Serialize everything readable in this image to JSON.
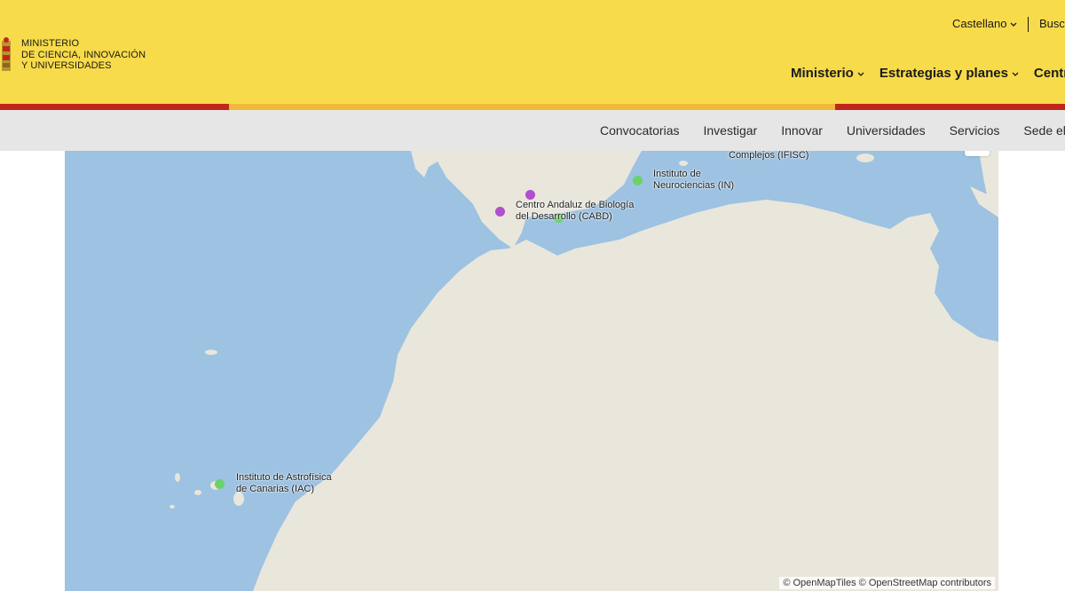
{
  "header": {
    "logo_lines": [
      "MINISTERIO",
      "DE CIENCIA, INNOVACIÓN",
      "Y UNIVERSIDADES"
    ],
    "language": "Castellano",
    "search": "Busc",
    "main_nav": [
      "Ministerio",
      "Estrategias y planes",
      "Centr"
    ]
  },
  "subnav": [
    "Convocatorias",
    "Investigar",
    "Innovar",
    "Universidades",
    "Servicios",
    "Sede elec"
  ],
  "map": {
    "attribution": "© OpenMapTiles © OpenStreetMap contributors",
    "colors": {
      "water": "#9dc2e2",
      "land": "#e9e6dc",
      "green_marker": "#6bd26b",
      "purple_marker": "#b14fcf"
    },
    "labels": {
      "ifisc": [
        "Complejos (IFISC)"
      ],
      "in": [
        "Instituto de",
        "Neurociencias (IN)"
      ],
      "cabd": [
        "Centro Andaluz de Biología",
        "del Desarrollo (CABD)"
      ],
      "iac": [
        "Instituto de Astrofísica",
        "de Canarias (IAC)"
      ]
    },
    "markers": [
      {
        "name": "Instituto de Neurociencias (IN)",
        "kind": "green"
      },
      {
        "name": "Centro Andaluz de Biología del Desarrollo (CABD)",
        "kind": "green"
      },
      {
        "name": "purple-1",
        "kind": "purple"
      },
      {
        "name": "purple-2",
        "kind": "purple"
      },
      {
        "name": "Instituto de Astrofísica de Canarias (IAC)",
        "kind": "green"
      }
    ]
  }
}
